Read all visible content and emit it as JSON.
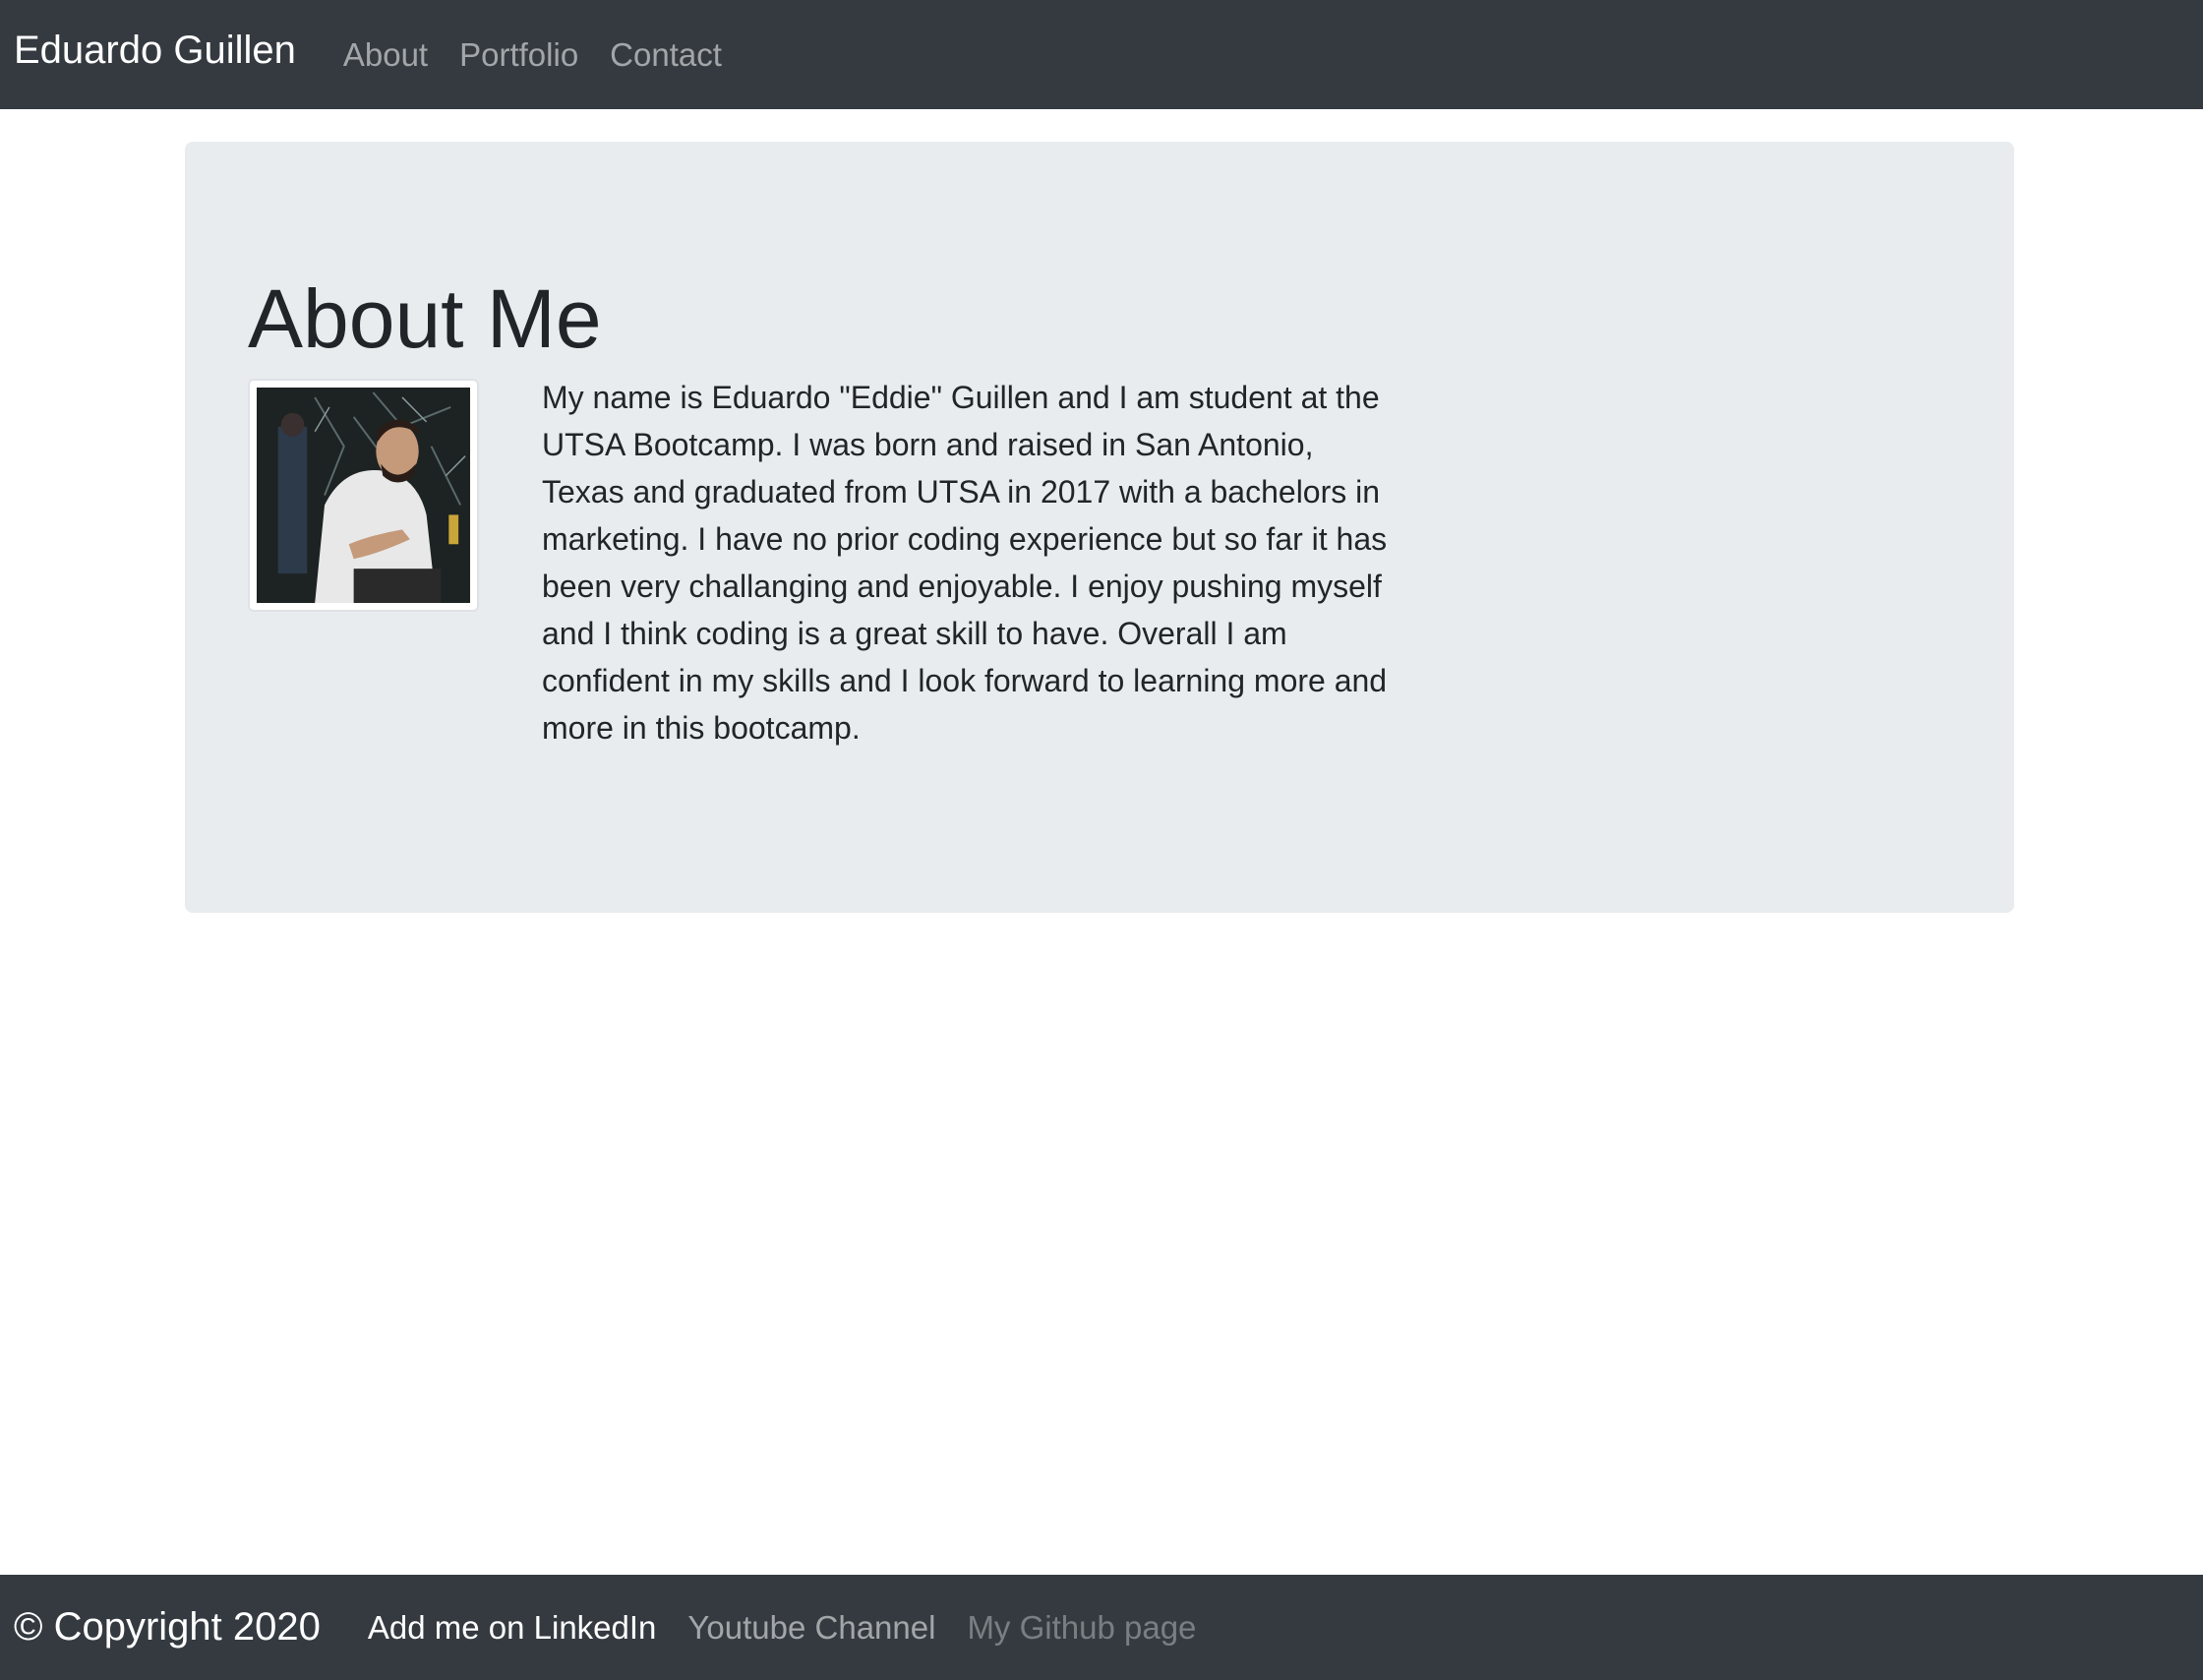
{
  "navbar": {
    "brand": "Eduardo Guillen",
    "links": [
      {
        "label": "About"
      },
      {
        "label": "Portfolio"
      },
      {
        "label": "Contact"
      }
    ]
  },
  "about": {
    "title": "About Me",
    "bio": "My name is Eduardo \"Eddie\" Guillen and I am student at the UTSA Bootcamp. I was born and raised in San Antonio, Texas and graduated from UTSA in 2017 with a bachelors in marketing. I have no prior coding experience but so far it has been very challanging and enjoyable. I enjoy pushing myself and I think coding is a great skill to have. Overall I am confident in my skills and I look forward to learning more and more in this bootcamp."
  },
  "footer": {
    "copyright": "© Copyright 2020",
    "links": [
      {
        "label": "Add me on LinkedIn"
      },
      {
        "label": "Youtube Channel"
      },
      {
        "label": "My Github page"
      }
    ]
  },
  "colors": {
    "navbar_bg": "#343a40",
    "jumbotron_bg": "#e9ecef",
    "text": "#212529"
  }
}
